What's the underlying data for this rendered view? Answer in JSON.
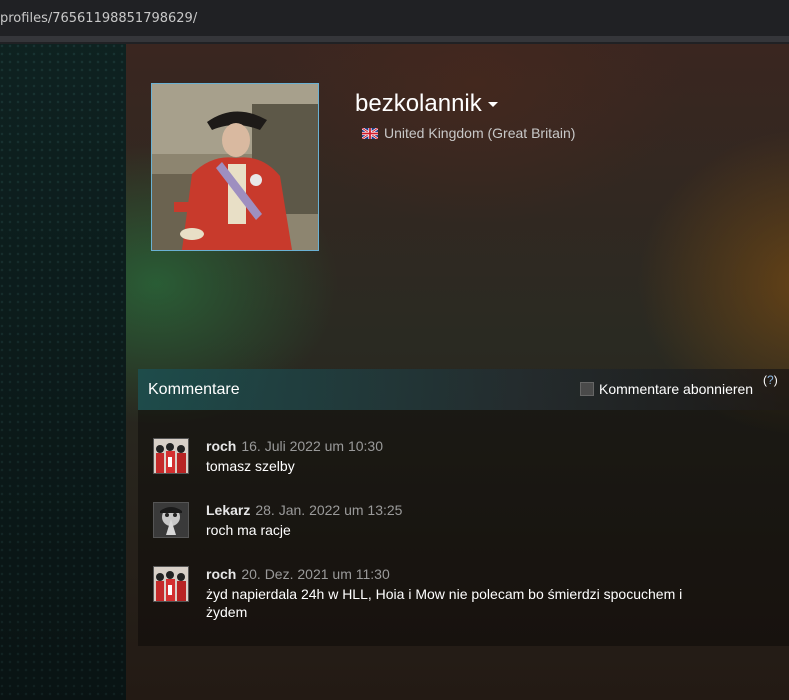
{
  "browser": {
    "url": "profiles/76561198851798629/"
  },
  "profile": {
    "persona_name": "bezkolannik",
    "location": "United Kingdom (Great Britain)"
  },
  "comments": {
    "title": "Kommentare",
    "subscribe_label": "Kommentare abonnieren",
    "help_label": "?",
    "items": [
      {
        "author": "roch",
        "timestamp": "16. Juli 2022 um 10:30",
        "text": "tomasz szelby"
      },
      {
        "author": "Lekarz",
        "timestamp": "28. Jan. 2022 um 13:25",
        "text": "roch ma racje"
      },
      {
        "author": "roch",
        "timestamp": "20. Dez. 2021 um 11:30",
        "text": "żyd napierdala 24h w HLL, Hoia i Mow nie polecam bo śmierdzi spocuchem i żydem"
      }
    ]
  }
}
